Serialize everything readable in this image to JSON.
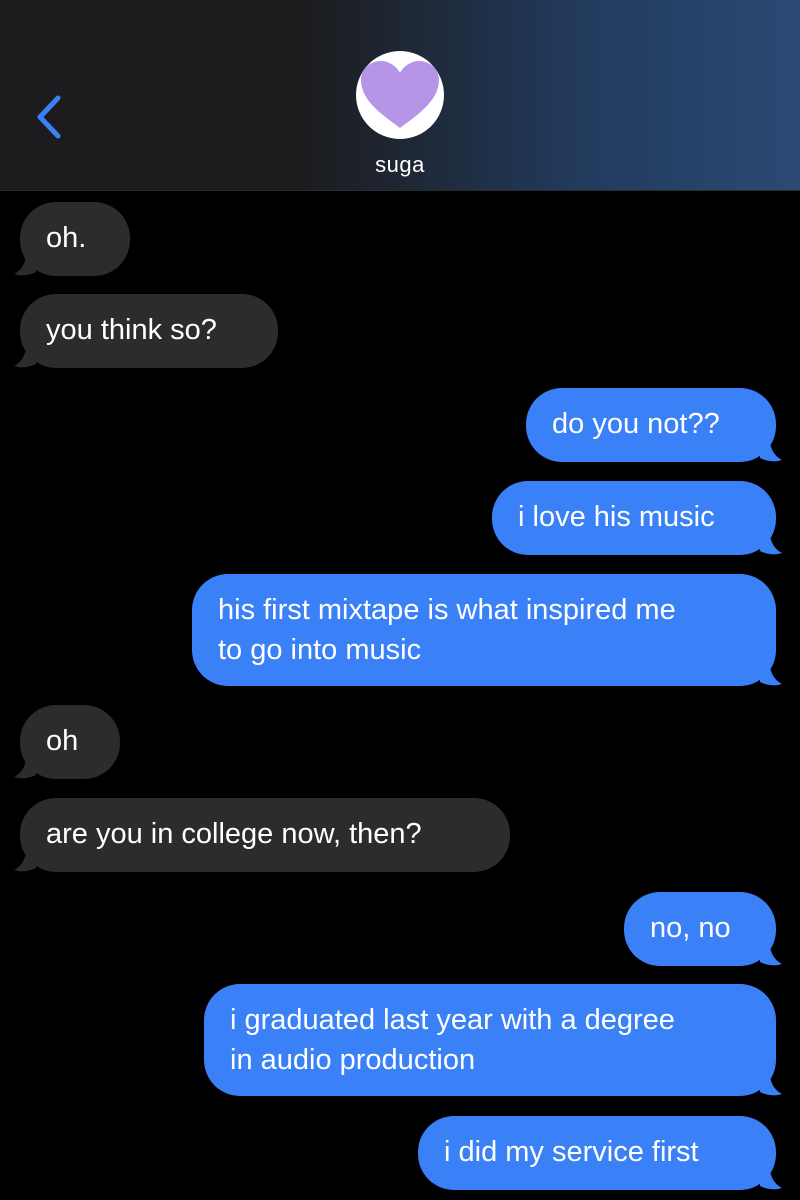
{
  "header": {
    "contact_name": "suga",
    "avatar_icon": "purple-heart-icon",
    "avatar_color": "#b795e6",
    "back_icon": "chevron-left-icon",
    "accent": "#3a80f6"
  },
  "messages": [
    {
      "side": "incoming",
      "text": "oh."
    },
    {
      "side": "incoming",
      "text": "you think so?"
    },
    {
      "side": "outgoing",
      "text": "do you not??"
    },
    {
      "side": "outgoing",
      "text": "i love his music"
    },
    {
      "side": "outgoing",
      "line1": "his first mixtape is what inspired me",
      "line2": "to go into music"
    },
    {
      "side": "incoming",
      "text": "oh"
    },
    {
      "side": "incoming",
      "text": "are you in college now, then?"
    },
    {
      "side": "outgoing",
      "text": "no, no"
    },
    {
      "side": "outgoing",
      "line1": "i graduated last year with a degree",
      "line2": "in audio production"
    },
    {
      "side": "outgoing",
      "text": "i did my service first"
    }
  ],
  "colors": {
    "incoming_bubble": "#2c2c2e",
    "outgoing_bubble": "#3a80f6",
    "background": "#000000"
  }
}
